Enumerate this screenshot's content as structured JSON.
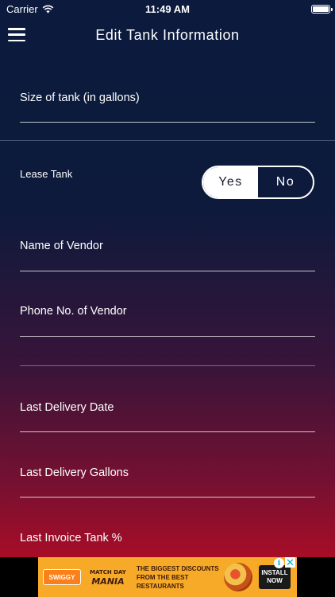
{
  "status_bar": {
    "carrier": "Carrier",
    "time": "11:49 AM"
  },
  "nav": {
    "title": "Edit Tank Information"
  },
  "form": {
    "tank_size_label": "Size of tank (in gallons)",
    "lease_tank": {
      "label": "Lease Tank",
      "options": [
        "Yes",
        "No"
      ],
      "selected": "Yes"
    },
    "vendor_name_label": "Name of Vendor",
    "vendor_phone_label": "Phone No. of Vendor",
    "last_delivery_date_label": "Last Delivery Date",
    "last_delivery_gallons_label": "Last Delivery Gallons",
    "last_invoice_tank_label": "Last Invoice Tank %"
  },
  "ad": {
    "logo": "SWIGGY",
    "brand_line1": "MATCH DAY",
    "brand_line2": "MANIA",
    "copy": "THE BIGGEST DISCOUNTS FROM THE BEST RESTAURANTS",
    "install_label": "INSTALL NOW",
    "info_glyph": "i",
    "close_glyph": "✕"
  },
  "colors": {
    "gradient_top": "#0b1a3d",
    "gradient_bottom": "#c20b22",
    "ad_background": "#f7a928"
  },
  "icons": [
    "menu-icon",
    "wifi-icon",
    "battery-icon",
    "info-icon",
    "close-icon"
  ]
}
